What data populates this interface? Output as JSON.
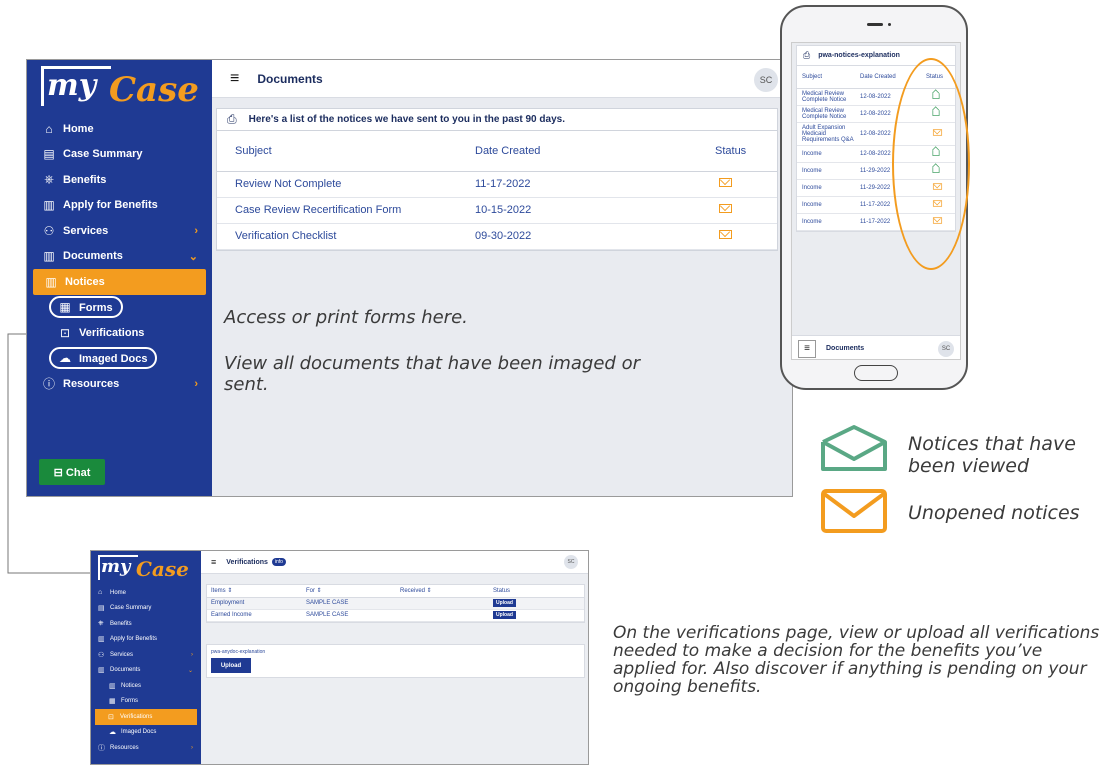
{
  "main": {
    "logo": {
      "my": "my",
      "case": "Case"
    },
    "nav": [
      {
        "icon": "⌂",
        "label": "Home"
      },
      {
        "icon": "▤",
        "label": "Case Summary"
      },
      {
        "icon": "⎈",
        "label": "Benefits"
      },
      {
        "icon": "▥",
        "label": "Apply for Benefits"
      },
      {
        "icon": "⚇",
        "label": "Services",
        "chevron": "›"
      },
      {
        "icon": "▥",
        "label": "Documents",
        "chevron": "⌄"
      },
      {
        "icon": "▥",
        "label": "Notices"
      },
      {
        "icon": "▦",
        "label": "Forms"
      },
      {
        "icon": "⊡",
        "label": "Verifications"
      },
      {
        "icon": "☁",
        "label": "Imaged Docs"
      },
      {
        "icon": "ⓘ",
        "label": "Resources",
        "chevron": "›"
      }
    ],
    "chat_label": "⊟ Chat",
    "header_title": "Documents",
    "avatar": "SC",
    "card_title": "Here's a list of the notices we have sent to you in the past 90 days.",
    "columns": [
      "Subject",
      "Date Created",
      "Status"
    ],
    "rows": [
      {
        "subject": "Review Not Complete",
        "date": "11-17-2022"
      },
      {
        "subject": "Case Review Recertification Form",
        "date": "10-15-2022"
      },
      {
        "subject": "Verification Checklist",
        "date": "09-30-2022"
      }
    ],
    "help_forms": "Access or print forms here.",
    "help_imaged": "View all documents that have been imaged or sent."
  },
  "phone": {
    "card_title": "pwa-notices-explanation",
    "columns": [
      "Subject",
      "Date Created",
      "Status"
    ],
    "rows": [
      {
        "subject": "Medical Review Complete Notice",
        "date": "12-08-2022",
        "status": "viewed"
      },
      {
        "subject": "Medical Review Complete Notice",
        "date": "12-08-2022",
        "status": "viewed"
      },
      {
        "subject": "Adult Expansion Medicaid Requirements Q&A",
        "date": "12-08-2022",
        "status": "unopened"
      },
      {
        "subject": "Income",
        "date": "12-08-2022",
        "status": "viewed"
      },
      {
        "subject": "Income",
        "date": "11-29-2022",
        "status": "viewed"
      },
      {
        "subject": "Income",
        "date": "11-29-2022",
        "status": "unopened"
      },
      {
        "subject": "Income",
        "date": "11-17-2022",
        "status": "unopened"
      },
      {
        "subject": "Income",
        "date": "11-17-2022",
        "status": "unopened"
      }
    ],
    "bottom_title": "Documents",
    "avatar": "SC"
  },
  "legend": {
    "viewed": "Notices that have been viewed",
    "unopened": "Unopened notices",
    "viewed_color": "#5aa885",
    "unopened_color": "#f39c1f"
  },
  "verifications": {
    "logo": {
      "my": "my",
      "case": "Case"
    },
    "nav": [
      {
        "icon": "⌂",
        "label": "Home"
      },
      {
        "icon": "▤",
        "label": "Case Summary"
      },
      {
        "icon": "⎈",
        "label": "Benefits"
      },
      {
        "icon": "▥",
        "label": "Apply for Benefits"
      },
      {
        "icon": "⚇",
        "label": "Services",
        "chevron": "›"
      },
      {
        "icon": "▥",
        "label": "Documents",
        "chevron": "⌄"
      },
      {
        "icon": "▥",
        "label": "Notices"
      },
      {
        "icon": "▦",
        "label": "Forms"
      },
      {
        "icon": "⊡",
        "label": "Verifications"
      },
      {
        "icon": "☁",
        "label": "Imaged Docs"
      },
      {
        "icon": "ⓘ",
        "label": "Resources",
        "chevron": "›"
      }
    ],
    "header_title": "Verifications",
    "badge": "info",
    "avatar": "SC",
    "columns": [
      "Items ⇕",
      "For ⇕",
      "Received ⇕",
      "Status"
    ],
    "rows": [
      {
        "item": "Employment",
        "for": "SAMPLE CASE",
        "received": "",
        "status": "Upload"
      },
      {
        "item": "Earned Income",
        "for": "SAMPLE CASE",
        "received": "",
        "status": "Upload"
      }
    ],
    "doc_label": "pwa-anydoc-explanation",
    "upload_label": "Upload",
    "description": "On the verifications page, view or upload all verifications needed to make a decision for the benefits you’ve applied for. Also discover if anything is pending on your ongoing benefits."
  }
}
